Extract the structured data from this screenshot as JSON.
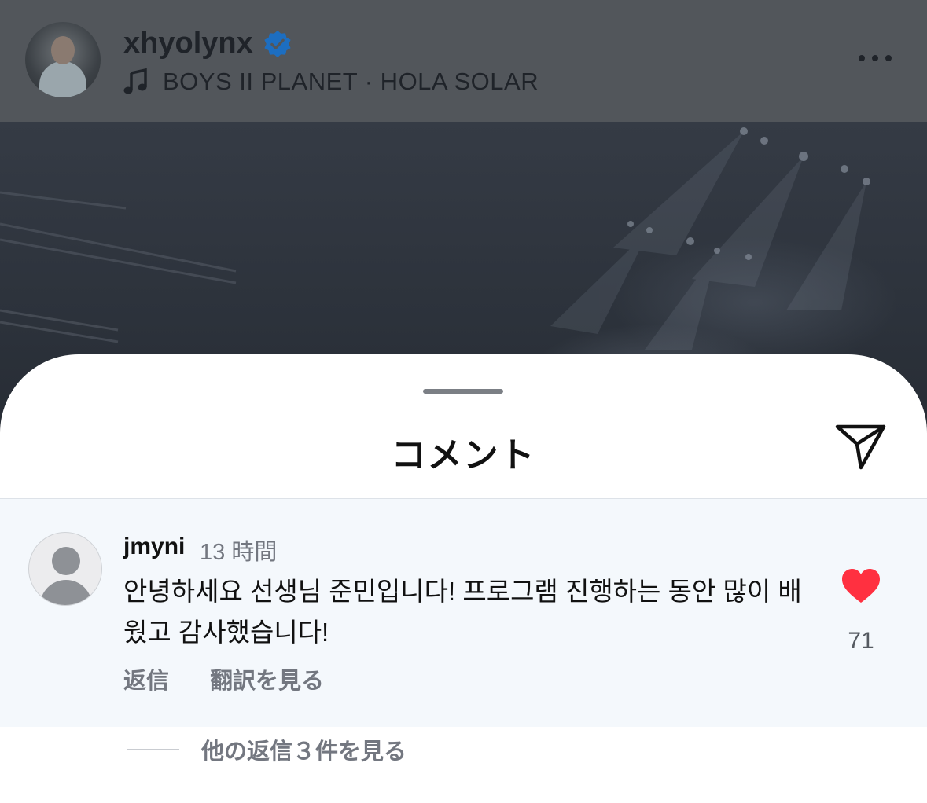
{
  "post": {
    "username": "xhyolynx",
    "verified": true,
    "music_label": "BOYS II PLANET · HOLA SOLAR",
    "icons": {
      "verified": "verified-badge-icon",
      "music": "music-note-icon",
      "more": "more-dots-icon"
    }
  },
  "sheet": {
    "title": "コメント",
    "share_icon": "send-icon"
  },
  "comment": {
    "username": "jmyni",
    "time": "13 時間",
    "text": "안녕하세요 선생님 준민입니다! 프로그램 진행하는 동안 많이 배웠고 감사했습니다!",
    "like_count": "71",
    "liked": true,
    "reply_label": "返信",
    "translate_label": "翻訳を見る",
    "view_replies_label": "他の返信３件を見る"
  },
  "colors": {
    "header_bg": "#52565b",
    "verified_blue": "#1d6ec1",
    "like_red": "#ff3040",
    "comment_bg": "#f4f8fc",
    "muted_text": "#737780"
  }
}
